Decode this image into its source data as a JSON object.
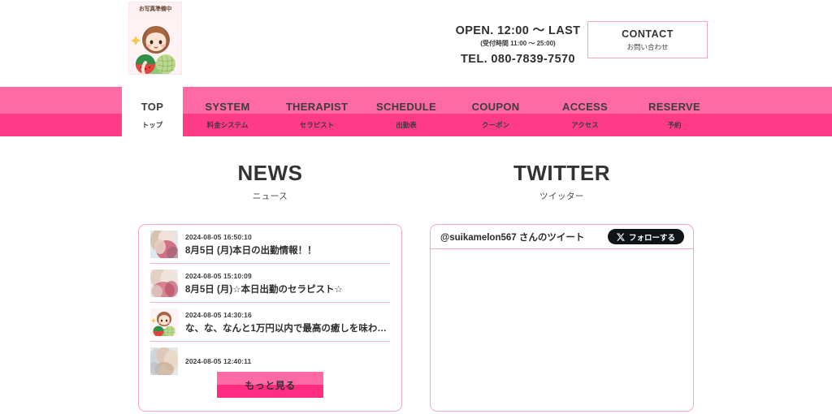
{
  "header": {
    "logo": {
      "caption": "お写真準備中",
      "icon": "girl-with-watermelon-illustration"
    },
    "open_line": "OPEN.  12:00 ～ LAST",
    "open_sub": "(受付時間 11:00 ～ 25:00)",
    "tel_line": "TEL.  080-7839-7570",
    "contact_button": {
      "title": "CONTACT",
      "sub": "お問い合わせ"
    }
  },
  "nav": {
    "items": [
      {
        "en": "TOP",
        "jp": "トップ",
        "active": true
      },
      {
        "en": "SYSTEM",
        "jp": "料金システム",
        "active": false
      },
      {
        "en": "THERAPIST",
        "jp": "セラピスト",
        "active": false
      },
      {
        "en": "SCHEDULE",
        "jp": "出勤表",
        "active": false
      },
      {
        "en": "COUPON",
        "jp": "クーポン",
        "active": false
      },
      {
        "en": "ACCESS",
        "jp": "アクセス",
        "active": false
      },
      {
        "en": "RESERVE",
        "jp": "予約",
        "active": false
      }
    ]
  },
  "news": {
    "title": "NEWS",
    "subtitle": "ニュース",
    "items": [
      {
        "date": "2024-08-05 16:50:10",
        "title": "8月5日 (月)本日の出勤情報！！",
        "thumb": "blurred-photo-thumbnail"
      },
      {
        "date": "2024-08-05 15:10:09",
        "title": "8月5日 (月)☆本日出勤のセラピスト☆",
        "thumb": "blurred-photo-thumbnail"
      },
      {
        "date": "2024-08-05 14:30:16",
        "title": "な、な、なんと1万円以内で最高の癒しを味わえ…",
        "thumb": "girl-with-watermelon-illustration"
      },
      {
        "date": "2024-08-05 12:40:11",
        "title": "",
        "thumb": "blurred-photo-thumbnail"
      }
    ],
    "more_button": "もっと見る"
  },
  "twitter": {
    "title": "TWITTER",
    "subtitle": "ツイッター",
    "handle_line": "@suikamelon567 さんのツイート",
    "follow_button": {
      "icon": "x-logo-icon",
      "label": "フォローする"
    }
  },
  "colors": {
    "nav_top_pink": "#ff69a4",
    "nav_bottom_pink": "#ff3b87",
    "border_pink": "#f9a7c6",
    "button_dark": "#0f1419"
  }
}
